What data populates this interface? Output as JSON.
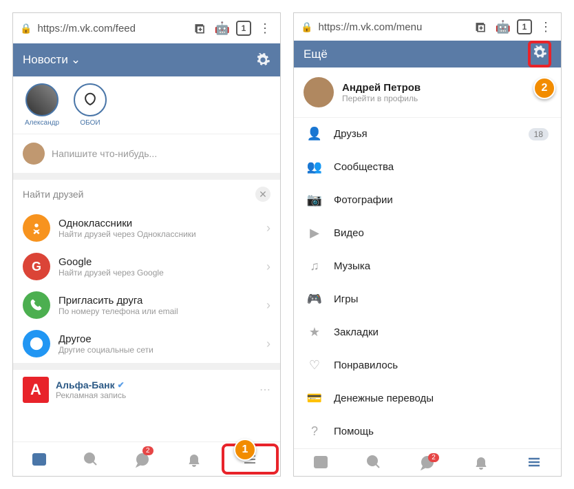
{
  "left": {
    "url": "https://m.vk.com/feed",
    "tab_count": "1",
    "header_title": "Новости",
    "stories": [
      {
        "name": "Александр"
      },
      {
        "name": "ОБОИ"
      }
    ],
    "composer_placeholder": "Напишите что-нибудь...",
    "find_friends": "Найти друзей",
    "items": [
      {
        "title": "Одноклассники",
        "sub": "Найти друзей через Одноклассники",
        "bg": "#f7931e"
      },
      {
        "title": "Google",
        "sub": "Найти друзей через Google",
        "bg": "#db4437",
        "letter": "G"
      },
      {
        "title": "Пригласить друга",
        "sub": "По номеру телефона или email",
        "bg": "#4caf50"
      },
      {
        "title": "Другое",
        "sub": "Другие социальные сети",
        "bg": "#2196f3"
      }
    ],
    "post": {
      "title": "Альфа-Банк",
      "sub": "Рекламная запись",
      "letter": "A"
    },
    "nav_badge": "2"
  },
  "right": {
    "url": "https://m.vk.com/menu",
    "tab_count": "1",
    "header_title": "Ещё",
    "profile_name": "Андрей Петров",
    "profile_sub": "Перейти в профиль",
    "menu": [
      {
        "label": "Друзья",
        "count": "18"
      },
      {
        "label": "Сообщества"
      },
      {
        "label": "Фотографии"
      },
      {
        "label": "Видео"
      },
      {
        "label": "Музыка"
      },
      {
        "label": "Игры"
      },
      {
        "label": "Закладки"
      },
      {
        "label": "Понравилось"
      },
      {
        "label": "Денежные переводы"
      },
      {
        "label": "Помощь"
      }
    ],
    "nav_badge": "2"
  },
  "callouts": {
    "one": "1",
    "two": "2"
  }
}
